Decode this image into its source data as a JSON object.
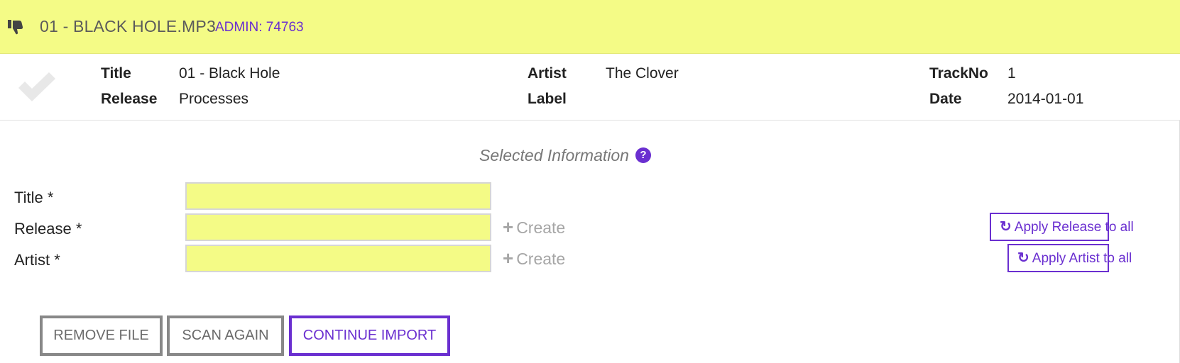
{
  "header": {
    "filename": "01 - BLACK HOLE.MP3",
    "admin_label": "ADMIN: 74763"
  },
  "metadata": {
    "title_label": "Title",
    "title_value": "01 - Black Hole",
    "release_label": "Release",
    "release_value": "Processes",
    "artist_label": "Artist",
    "artist_value": "The Clover",
    "label_label": "Label",
    "label_value": "",
    "trackno_label": "TrackNo",
    "trackno_value": "1",
    "date_label": "Date",
    "date_value": "2014-01-01"
  },
  "selected": {
    "heading": "Selected Information",
    "help_glyph": "?"
  },
  "form": {
    "title_label": "Title *",
    "title_value": "",
    "release_label": "Release *",
    "release_value": "",
    "artist_label": "Artist *",
    "artist_value": "",
    "create_release_label": "Create",
    "create_artist_label": "Create",
    "apply_release_label": "Apply Release to all",
    "apply_artist_label": "Apply Artist to all"
  },
  "actions": {
    "remove_label": "REMOVE FILE",
    "scan_label": "SCAN AGAIN",
    "continue_label": "CONTINUE IMPORT"
  },
  "colors": {
    "accent": "#6a2fd0",
    "highlight": "#f4fb86",
    "muted": "#a6a6a6"
  },
  "icons": {
    "status": "thumbs-down-icon",
    "match": "checkmark-icon",
    "create": "plus-icon",
    "apply": "refresh-icon"
  }
}
